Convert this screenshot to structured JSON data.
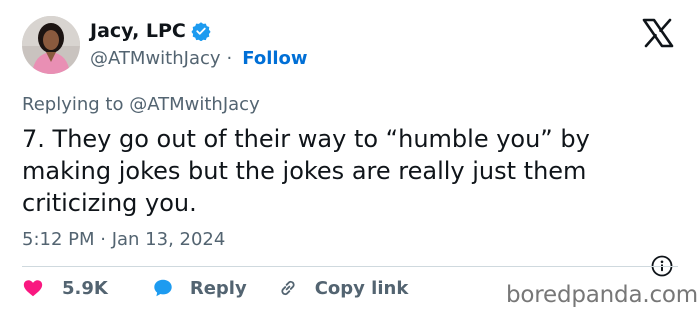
{
  "author": {
    "display_name": "Jacy, LPC",
    "handle": "@ATMwithJacy",
    "separator": "·",
    "follow_label": "Follow",
    "verified": true
  },
  "tweet": {
    "replying_to": "Replying to @ATMwithJacy",
    "text": "7. They go out of their way to “humble you” by making jokes but the jokes are really just them criticizing you.",
    "timestamp": "5:12 PM · Jan 13, 2024"
  },
  "actions": {
    "like_count": "5.9K",
    "reply_label": "Reply",
    "copy_link_label": "Copy link"
  },
  "watermark": "boredpanda.com",
  "colors": {
    "verified_blue": "#1d9bf0",
    "follow_blue": "#006fd6",
    "like_red": "#f91880",
    "reply_blue": "#1d9bf0",
    "muted_text": "#536471",
    "main_text": "#0f1419"
  },
  "icons": [
    "verified-badge-icon",
    "x-logo-icon",
    "info-icon",
    "heart-icon",
    "reply-bubble-icon",
    "link-icon"
  ]
}
